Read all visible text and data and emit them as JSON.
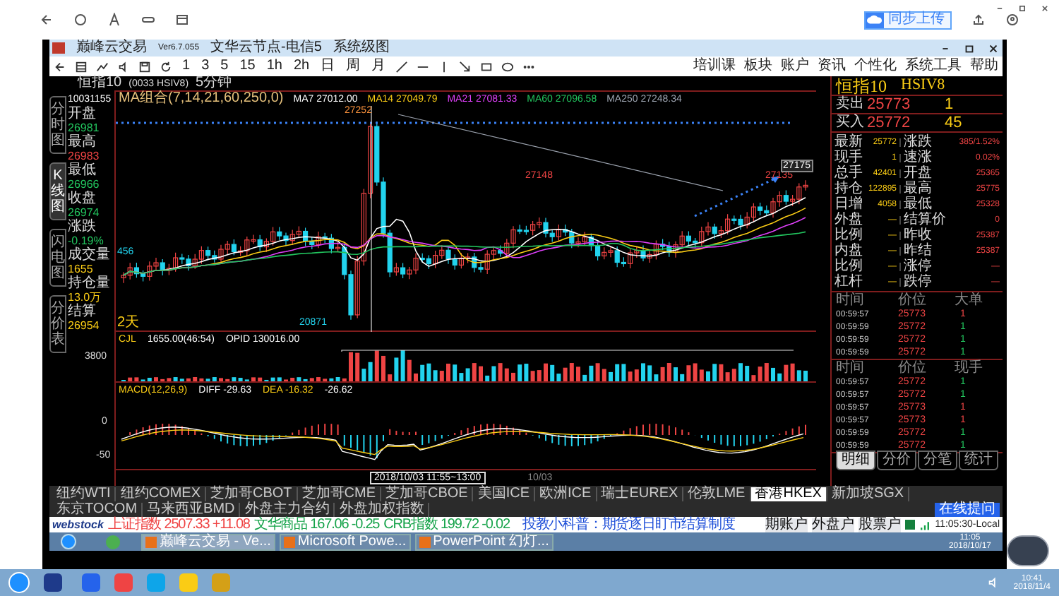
{
  "browser": {
    "upload_button": "同步上传"
  },
  "app": {
    "title": "巅峰云交易",
    "version": "Ver6.7.055",
    "node": "文华云节点-电信5",
    "menu_title": "系统级图"
  },
  "toolbar": {
    "periods": [
      "1",
      "3",
      "5",
      "15",
      "1h",
      "2h",
      "日",
      "周",
      "月"
    ],
    "menu": [
      "培训课",
      "板块",
      "账户",
      "资讯",
      "个性化",
      "系统工具",
      "帮助"
    ]
  },
  "chart_header": {
    "name": "恒指10",
    "code": "(0033 HSIV8)",
    "period": "5分钟"
  },
  "side_tabs": [
    {
      "label": "分时图",
      "selected": false
    },
    {
      "label": "K线图",
      "selected": true
    },
    {
      "label": "闪电图",
      "selected": false
    },
    {
      "label": "分价表",
      "selected": false
    }
  ],
  "info": {
    "time": "10031155",
    "items": [
      {
        "label": "开盘",
        "value": "26981",
        "color": "#22c55e"
      },
      {
        "label": "最高",
        "value": "26983",
        "color": "#ef4444"
      },
      {
        "label": "最低",
        "value": "26966",
        "color": "#22c55e"
      },
      {
        "label": "收盘",
        "value": "26974",
        "color": "#22c55e"
      },
      {
        "label": "涨跌",
        "value": "-0.19%",
        "color": "#22c55e"
      },
      {
        "label": "成交量",
        "value": "1655",
        "color": "#facc15"
      },
      {
        "label": "持仓量",
        "value": "13.0万",
        "color": "#facc15"
      },
      {
        "label": "结算",
        "value": "26954",
        "color": "#facc15"
      }
    ]
  },
  "legend": [
    {
      "text": "MA组合(7,14,21,60,250,0)",
      "color": "#e5c07b"
    },
    {
      "text": "MA7 27012.00",
      "color": "#ffffff"
    },
    {
      "text": "MA14 27049.79",
      "color": "#facc15"
    },
    {
      "text": "MA21 27081.33",
      "color": "#e040fb"
    },
    {
      "text": "MA60 27096.58",
      "color": "#22c55e"
    },
    {
      "text": "MA250 27248.34",
      "color": "#9ca3af"
    }
  ],
  "main_chart": {
    "high_label": "27252",
    "mid_label": "27148",
    "right_label": "27135",
    "low_label": "20871",
    "axis_label": "27175",
    "left_label": "456",
    "corner_label": "2天"
  },
  "volume": {
    "title": "CJL",
    "value": "1655.00(46:54)",
    "open_interest": "OPID 130016.00",
    "tick": "3800"
  },
  "macd": {
    "title": "MACD(12,26,9)",
    "diff": "DIFF -29.63",
    "dea": "DEA -16.32",
    "value": "-26.62",
    "ticks": [
      "0",
      "-50"
    ]
  },
  "cursor": {
    "date_range": "2018/10/03 11:55~13:00",
    "date_label": "10/03"
  },
  "quote": {
    "name": "恒指10",
    "code": "HSIV8",
    "sell": {
      "label": "卖出",
      "price": "25773",
      "qty": "1"
    },
    "buy": {
      "label": "买入",
      "price": "25772",
      "qty": "45"
    },
    "grid": [
      [
        "最新",
        "25772",
        "涨跌",
        "385/1.52%"
      ],
      [
        "现手",
        "1",
        "速涨",
        "0.02%"
      ],
      [
        "总手",
        "42401",
        "开盘",
        "25365"
      ],
      [
        "持仓",
        "122895",
        "最高",
        "25775"
      ],
      [
        "日增",
        "4058",
        "最低",
        "25328"
      ],
      [
        "外盘",
        "—",
        "结算价",
        "0"
      ],
      [
        "比例",
        "—",
        "昨收",
        "25387"
      ],
      [
        "内盘",
        "—",
        "昨结",
        "25387"
      ],
      [
        "比例",
        "—",
        "涨停",
        "—"
      ],
      [
        "杠杆",
        "—",
        "跌停",
        "—"
      ]
    ]
  },
  "ticks_large": {
    "columns": [
      "时间",
      "价位",
      "大单"
    ],
    "rows": [
      {
        "time": "00:59:57",
        "price": "25773",
        "qty": "1",
        "color": "#ef4444"
      },
      {
        "time": "00:59:59",
        "price": "25772",
        "qty": "1",
        "color": "#22c55e"
      },
      {
        "time": "00:59:59",
        "price": "25772",
        "qty": "1",
        "color": "#22c55e"
      },
      {
        "time": "00:59:59",
        "price": "25772",
        "qty": "1",
        "color": "#22c55e"
      }
    ]
  },
  "ticks": {
    "columns": [
      "时间",
      "价位",
      "现手"
    ],
    "rows": [
      {
        "time": "00:59:57",
        "price": "25772",
        "qty": "1",
        "color": "#22c55e"
      },
      {
        "time": "00:59:57",
        "price": "25772",
        "qty": "1",
        "color": "#22c55e"
      },
      {
        "time": "00:59:57",
        "price": "25773",
        "qty": "1",
        "color": "#ef4444"
      },
      {
        "time": "00:59:57",
        "price": "25773",
        "qty": "1",
        "color": "#ef4444"
      },
      {
        "time": "00:59:59",
        "price": "25772",
        "qty": "1",
        "color": "#22c55e"
      },
      {
        "time": "00:59:59",
        "price": "25772",
        "qty": "1",
        "color": "#22c55e"
      }
    ]
  },
  "panel_tabs": [
    {
      "label": "明细",
      "selected": true
    },
    {
      "label": "分价",
      "selected": false
    },
    {
      "label": "分笔",
      "selected": false
    },
    {
      "label": "统计",
      "selected": false
    }
  ],
  "market_tabs": [
    {
      "label": "纽约WTI",
      "selected": false
    },
    {
      "label": "纽约COMEX",
      "selected": false
    },
    {
      "label": "芝加哥CBOT",
      "selected": false
    },
    {
      "label": "芝加哥CME",
      "selected": false
    },
    {
      "label": "芝加哥CBOE",
      "selected": false
    },
    {
      "label": "美国ICE",
      "selected": false
    },
    {
      "label": "欧洲ICE",
      "selected": false
    },
    {
      "label": "瑞士EUREX",
      "selected": false
    },
    {
      "label": "伦敦LME",
      "selected": false
    },
    {
      "label": "香港HKEX",
      "selected": true
    },
    {
      "label": "新加坡SGX",
      "selected": false
    },
    {
      "label": "东京TOCOM",
      "selected": false
    },
    {
      "label": "马来西亚BMD",
      "selected": false
    },
    {
      "label": "外盘主力合约",
      "selected": false
    },
    {
      "label": "外盘加权指数",
      "selected": false
    }
  ],
  "online_button": "在线提问",
  "status_bar": {
    "logo": "webstock",
    "indices": [
      {
        "text": "上证指数 2507.33 +11.08",
        "color": "#ef4444"
      },
      {
        "text": "文华商品 167.06 -0.25",
        "color": "#16a34a"
      },
      {
        "text": "CRB指数 199.72 -0.02",
        "color": "#16a34a"
      }
    ],
    "notice": "投教小科普：期货逐日盯市结算制度",
    "accounts": [
      "期账户",
      "外盘户",
      "股票户"
    ],
    "time": "11:05:30-Local"
  },
  "inner_taskbar": {
    "items": [
      {
        "label": "巅峰云交易 - Ve...",
        "selected": true
      },
      {
        "label": "Microsoft Powe...",
        "selected": false
      },
      {
        "label": "PowerPoint 幻灯...",
        "selected": false
      }
    ],
    "time": "11:05",
    "date": "2018/10/17"
  },
  "outer_taskbar": {
    "time": "10:41",
    "date": "2018/11/4"
  }
}
